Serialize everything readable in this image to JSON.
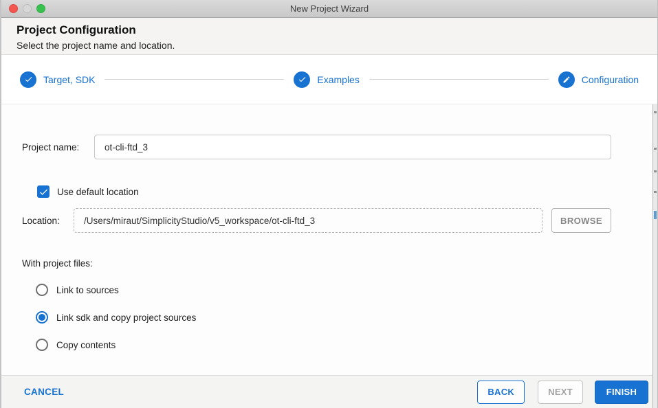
{
  "window": {
    "title": "New Project Wizard"
  },
  "header": {
    "title": "Project Configuration",
    "subtitle": "Select the project name and location."
  },
  "stepper": {
    "steps": [
      {
        "label": "Target, SDK",
        "icon": "check-icon",
        "state": "completed"
      },
      {
        "label": "Examples",
        "icon": "check-icon",
        "state": "completed"
      },
      {
        "label": "Configuration",
        "icon": "pencil-icon",
        "state": "active"
      }
    ]
  },
  "form": {
    "project_name": {
      "label": "Project name:",
      "value": "ot-cli-ftd_3"
    },
    "use_default_location": {
      "label": "Use default location",
      "checked": true
    },
    "location": {
      "label": "Location:",
      "value": "/Users/miraut/SimplicityStudio/v5_workspace/ot-cli-ftd_3",
      "readonly": true
    },
    "browse_button": {
      "label": "BROWSE"
    },
    "with_project_files": {
      "label": "With project files:",
      "options": [
        {
          "label": "Link to sources",
          "selected": false
        },
        {
          "label": "Link sdk and copy project sources",
          "selected": true
        },
        {
          "label": "Copy contents",
          "selected": false
        }
      ]
    }
  },
  "footer": {
    "cancel": "CANCEL",
    "back": "BACK",
    "next": "NEXT",
    "finish": "FINISH",
    "next_enabled": false
  },
  "colors": {
    "accent": "#1872d2"
  }
}
